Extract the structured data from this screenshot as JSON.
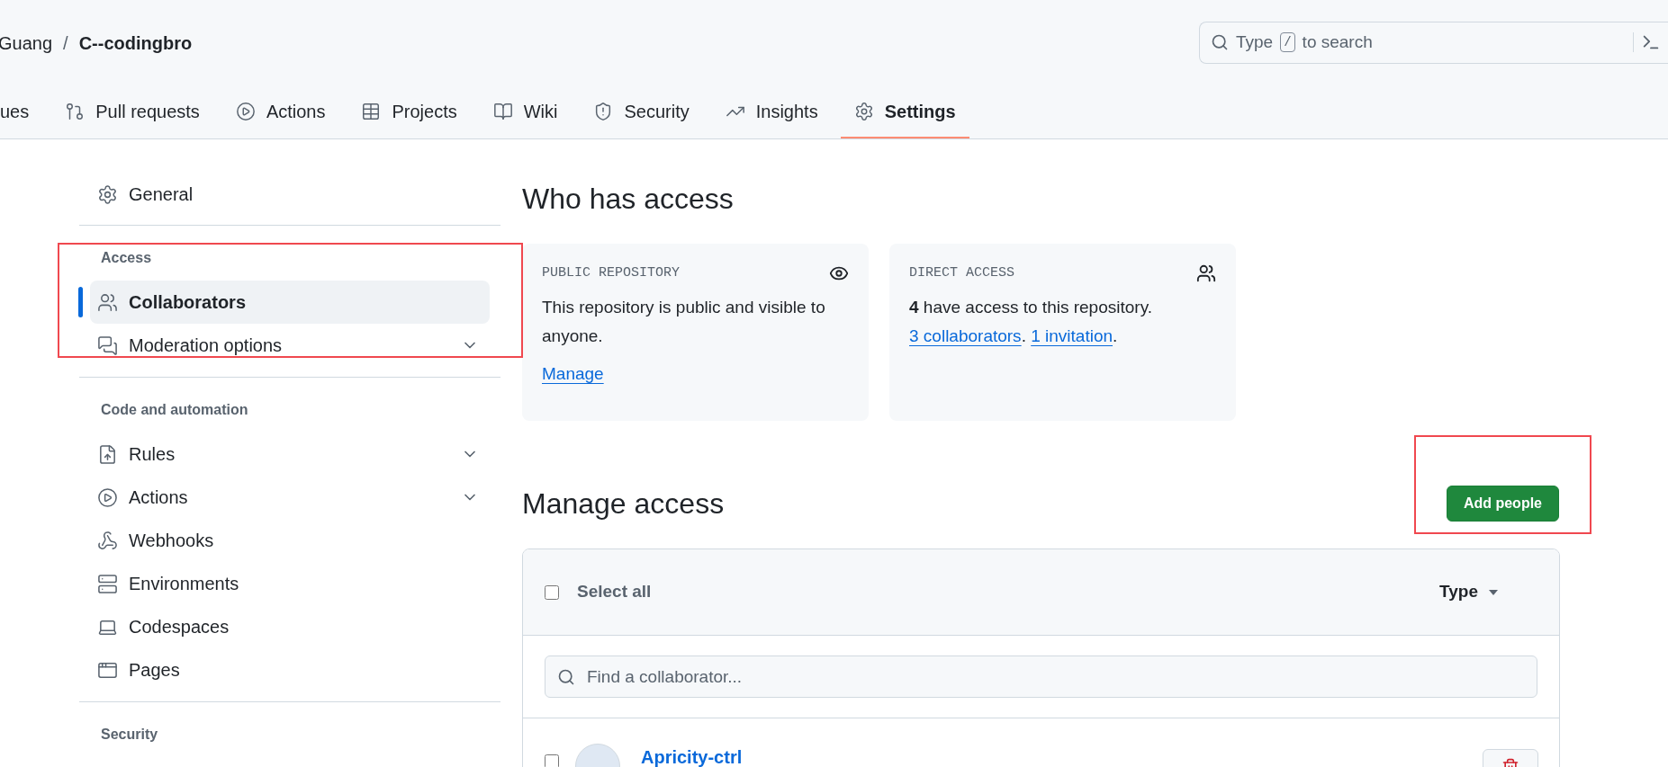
{
  "breadcrumb": {
    "owner": "Guang",
    "separator": "/",
    "repo": "C--codingbro"
  },
  "search": {
    "before": "Type",
    "key": "/",
    "after": "to search"
  },
  "tabs": [
    {
      "label": "ues",
      "selected": false
    },
    {
      "label": "Pull requests",
      "selected": false
    },
    {
      "label": "Actions",
      "selected": false
    },
    {
      "label": "Projects",
      "selected": false
    },
    {
      "label": "Wiki",
      "selected": false
    },
    {
      "label": "Security",
      "selected": false
    },
    {
      "label": "Insights",
      "selected": false
    },
    {
      "label": "Settings",
      "selected": true
    }
  ],
  "sidebar": [
    {
      "items": [
        {
          "label": "General",
          "selected": false,
          "expandable": false
        }
      ]
    },
    {
      "heading": "Access",
      "items": [
        {
          "label": "Collaborators",
          "selected": true,
          "expandable": false
        },
        {
          "label": "Moderation options",
          "selected": false,
          "expandable": true
        }
      ]
    },
    {
      "heading": "Code and automation",
      "items": [
        {
          "label": "Rules",
          "selected": false,
          "expandable": true
        },
        {
          "label": "Actions",
          "selected": false,
          "expandable": true
        },
        {
          "label": "Webhooks",
          "selected": false,
          "expandable": false
        },
        {
          "label": "Environments",
          "selected": false,
          "expandable": false
        },
        {
          "label": "Codespaces",
          "selected": false,
          "expandable": false
        },
        {
          "label": "Pages",
          "selected": false,
          "expandable": false
        }
      ]
    },
    {
      "heading": "Security"
    }
  ],
  "who_has_access": {
    "title": "Who has access",
    "public_card": {
      "label": "PUBLIC REPOSITORY",
      "text": "This repository is public and visible to anyone.",
      "link": "Manage"
    },
    "direct_card": {
      "label": "DIRECT ACCESS",
      "summary": "**4** have access to this repository.",
      "links": [
        {
          "text": "3 collaborators",
          "after": "."
        },
        {
          "text": "1 invitation",
          "after": "."
        }
      ]
    }
  },
  "manage_access": {
    "title": "Manage access",
    "button": "Add people",
    "select_all": {
      "label": "Select all",
      "checked": false
    },
    "type_filter": "Type",
    "search_placeholder": "Find a collaborator...",
    "rows": [
      {
        "name": "Apricity-ctrl",
        "checked": false
      }
    ]
  }
}
